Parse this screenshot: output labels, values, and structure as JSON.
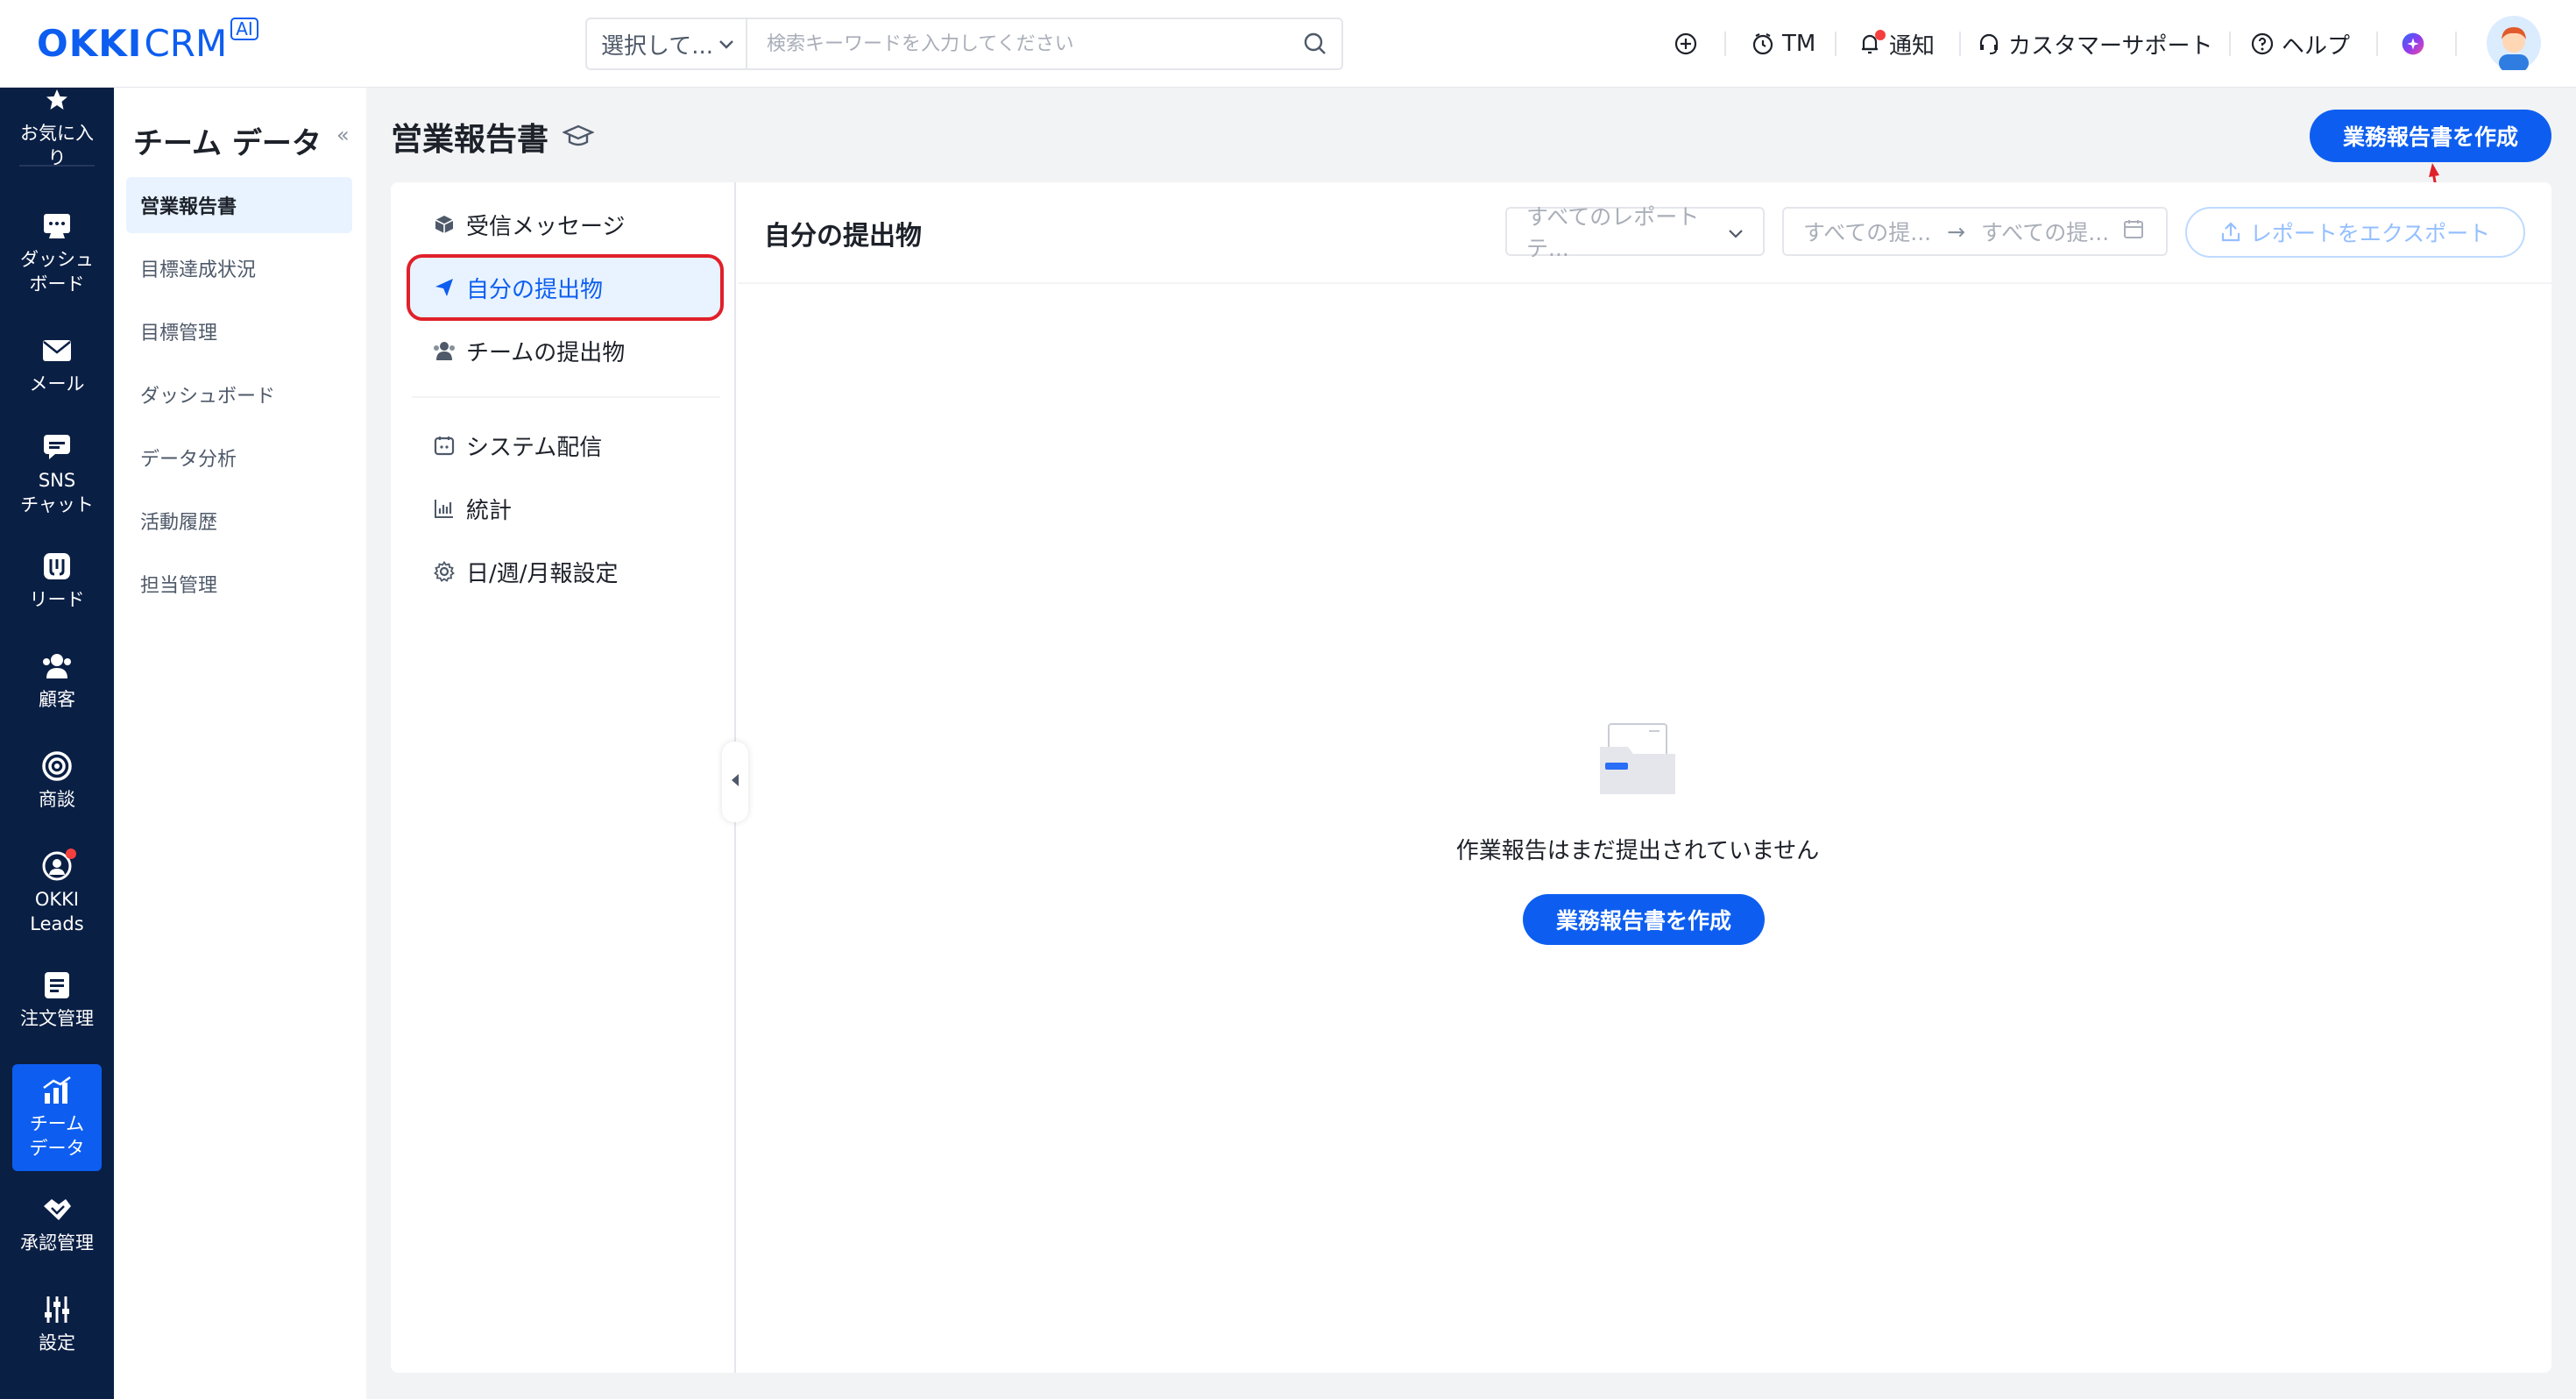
{
  "topbar": {
    "logo_main": "OKKI",
    "logo_crm": "CRM",
    "logo_ai": "AI",
    "search_select": "選択して...",
    "search_placeholder": "検索キーワードを入力してください",
    "tm_label": "TM",
    "notify_label": "通知",
    "support_label": "カスタマーサポート",
    "help_label": "ヘルプ"
  },
  "leftnav": {
    "items": [
      {
        "label": "お気に入り",
        "icon": "star-icon"
      },
      {
        "label": "ダッシュボード",
        "icon": "dashboard-icon"
      },
      {
        "label": "メール",
        "icon": "mail-icon"
      },
      {
        "label": "SNSチャット",
        "icon": "chat-icon"
      },
      {
        "label": "リード",
        "icon": "lead-icon"
      },
      {
        "label": "顧客",
        "icon": "customers-icon"
      },
      {
        "label": "商談",
        "icon": "target-icon"
      },
      {
        "label": "OKKI Leads",
        "icon": "okki-leads-icon"
      },
      {
        "label": "注文管理",
        "icon": "order-icon"
      },
      {
        "label": "チームデータ",
        "icon": "team-data-icon"
      },
      {
        "label": "承認管理",
        "icon": "approval-icon"
      },
      {
        "label": "設定",
        "icon": "settings-icon"
      }
    ],
    "labels": {
      "fav_1": "お気に入",
      "fav_2": "り",
      "dash_1": "ダッシュ",
      "dash_2": "ボード",
      "sns_1": "SNS",
      "sns_2": "チャット",
      "okki_1": "OKKI",
      "okki_2": "Leads",
      "team_1": "チーム",
      "team_2": "データ"
    }
  },
  "subnav": {
    "title": "チーム データ",
    "collapse": "«",
    "items": [
      {
        "label": "営業報告書"
      },
      {
        "label": "目標達成状況"
      },
      {
        "label": "目標管理"
      },
      {
        "label": "ダッシュボード"
      },
      {
        "label": "データ分析"
      },
      {
        "label": "活動履歴"
      },
      {
        "label": "担当管理"
      }
    ]
  },
  "page": {
    "title": "営業報告書",
    "create_button": "業務報告書を作成"
  },
  "report_menu": {
    "items": [
      {
        "label": "受信メッセージ",
        "icon": "box-icon"
      },
      {
        "label": "自分の提出物",
        "icon": "send-icon"
      },
      {
        "label": "チームの提出物",
        "icon": "team-icon"
      },
      {
        "label": "システム配信",
        "icon": "calendar-icon"
      },
      {
        "label": "統計",
        "icon": "bar-chart-icon"
      },
      {
        "label": "日/週/月報設定",
        "icon": "gear-icon"
      }
    ]
  },
  "content": {
    "title": "自分の提出物",
    "template_filter": "すべてのレポートテ...",
    "date_from": "すべての提...",
    "date_to": "すべての提...",
    "date_arrow": "→",
    "export_button": "レポートをエクスポート",
    "empty_text": "作業報告はまだ提出されていません",
    "empty_button": "業務報告書を作成"
  },
  "colors": {
    "primary": "#0d5ef0",
    "nav_bg": "#0a1f44",
    "highlight_box": "#e0202a",
    "badge": "#f53f3f"
  }
}
